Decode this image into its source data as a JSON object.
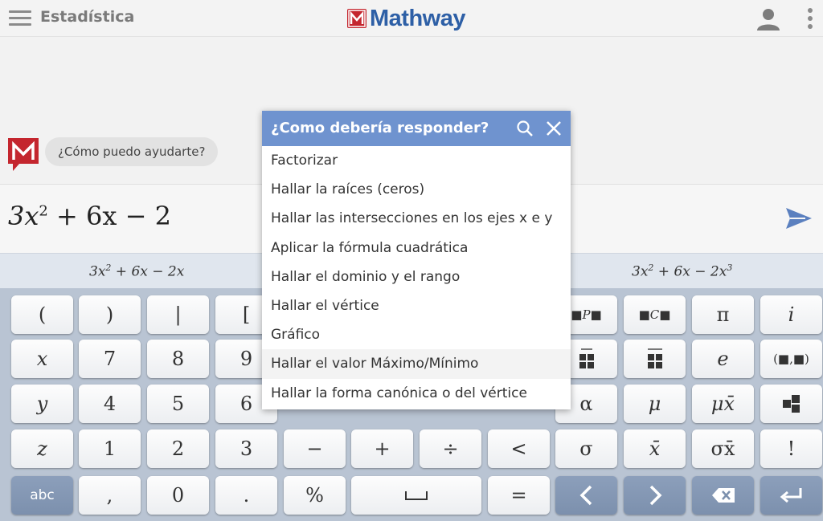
{
  "header": {
    "title": "Estadística",
    "logo_text": "Mathway"
  },
  "chat": {
    "bot_message": "¿Cómo puedo ayudarte?"
  },
  "input": {
    "expression_base": "3x",
    "expression_exp": "2",
    "expression_rest": " + 6x − 2"
  },
  "suggestions": [
    {
      "base": "3x",
      "exp": "2",
      "rest": " + 6x − 2x",
      "exp2": ""
    },
    {
      "base": "3x",
      "exp": "2",
      "rest": " + 6x − 2x",
      "exp2": "3"
    }
  ],
  "dialog": {
    "title": "¿Como debería responder?",
    "options": [
      "Factorizar",
      "Hallar la raíces (ceros)",
      "Hallar las intersecciones en los ejes x e y",
      "Aplicar la fórmula cuadrática",
      "Hallar el dominio y el rango",
      "Hallar el vértice",
      "Gráfico",
      "Hallar el valor Máximo/Mínimo",
      "Hallar la forma canónica o del vértice"
    ],
    "highlighted_index": 7
  },
  "keyboard": {
    "rows": [
      [
        "(",
        ")",
        "|",
        "[",
        "",
        "",
        "",
        "",
        "■P■",
        "■C■",
        "π",
        "i"
      ],
      [
        "x",
        "7",
        "8",
        "9",
        "",
        "",
        "",
        "",
        "",
        "",
        "e",
        "(■,■)"
      ],
      [
        "y",
        "4",
        "5",
        "6",
        "",
        "",
        "",
        "",
        "α",
        "μ",
        "μx̄",
        ""
      ],
      [
        "z",
        "1",
        "2",
        "3",
        "−",
        "+",
        "÷",
        "<",
        "σ",
        "x̄",
        "σx̄",
        "!"
      ],
      [
        "abc",
        ",",
        "0",
        ".",
        "%",
        "",
        "=",
        "",
        "",
        "",
        "",
        ""
      ]
    ]
  },
  "colors": {
    "accent": "#6f93cf",
    "brand_red": "#c4262e",
    "brand_blue": "#2d5fa6",
    "keyboard_bg": "#b9c4d3",
    "dark_key": "#7c90ad"
  }
}
